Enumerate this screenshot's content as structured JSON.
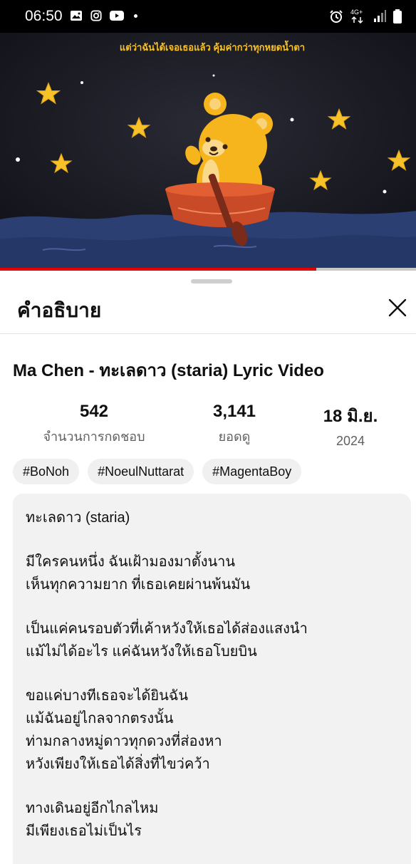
{
  "status_bar": {
    "time": "06:50",
    "left_icons": [
      "gallery-icon",
      "instagram-icon",
      "youtube-icon",
      "notification-dot"
    ],
    "right_icons": [
      "alarm-icon",
      "4g-data-icon",
      "signal-icon",
      "battery-icon"
    ],
    "network_label": "4G+"
  },
  "video": {
    "overlay_caption": "แต่ว่าฉันได้เจอเธอแล้ว คุ้มค่ากว่าทุกหยดน้ำตา",
    "progress_fraction": 0.76,
    "colors": {
      "progress": "#e60000",
      "sea": "#2c3f73",
      "bear": "#f6b51d",
      "boat": "#c94a26"
    }
  },
  "sheet": {
    "title": "คำอธิบาย",
    "video_title": "Ma Chen - ทะเลดาว (staria) Lyric Video",
    "stats": [
      {
        "value": "542",
        "label": "จำนวนการกดชอบ"
      },
      {
        "value": "3,141",
        "label": "ยอดดู"
      },
      {
        "value": "18 มิ.ย.",
        "label": "2024"
      }
    ],
    "tags": [
      "#BoNoh",
      "#NoeulNuttarat",
      "#MagentaBoy"
    ],
    "description": {
      "stanza1": [
        "ทะเลดาว (staria)"
      ],
      "stanza2": [
        "มีใครคนหนึ่ง ฉันเฝ้ามองมาตั้งนาน",
        "เห็นทุกความยาก ที่เธอเคยผ่านพ้นมัน"
      ],
      "stanza3": [
        "เป็นแค่คนรอบตัวที่เค้าหวังให้เธอได้ส่องแสงนำ",
        "แม้ไม่ได้อะไร แค่ฉันหวังให้เธอโบยบิน"
      ],
      "stanza4": [
        "ขอแค่บางทีเธอจะได้ยินฉัน",
        "แม้ฉันอยู่ไกลจากตรงนั้น",
        "ท่ามกลางหมู่ดาวทุกดวงที่ส่องหา",
        "หวังเพียงให้เธอได้สิ่งที่ไขว่คว้า"
      ],
      "stanza5": [
        "ทางเดินอยู่อีกไกลไหม",
        "มีเพียงเธอไม่เป็นไร"
      ]
    }
  }
}
